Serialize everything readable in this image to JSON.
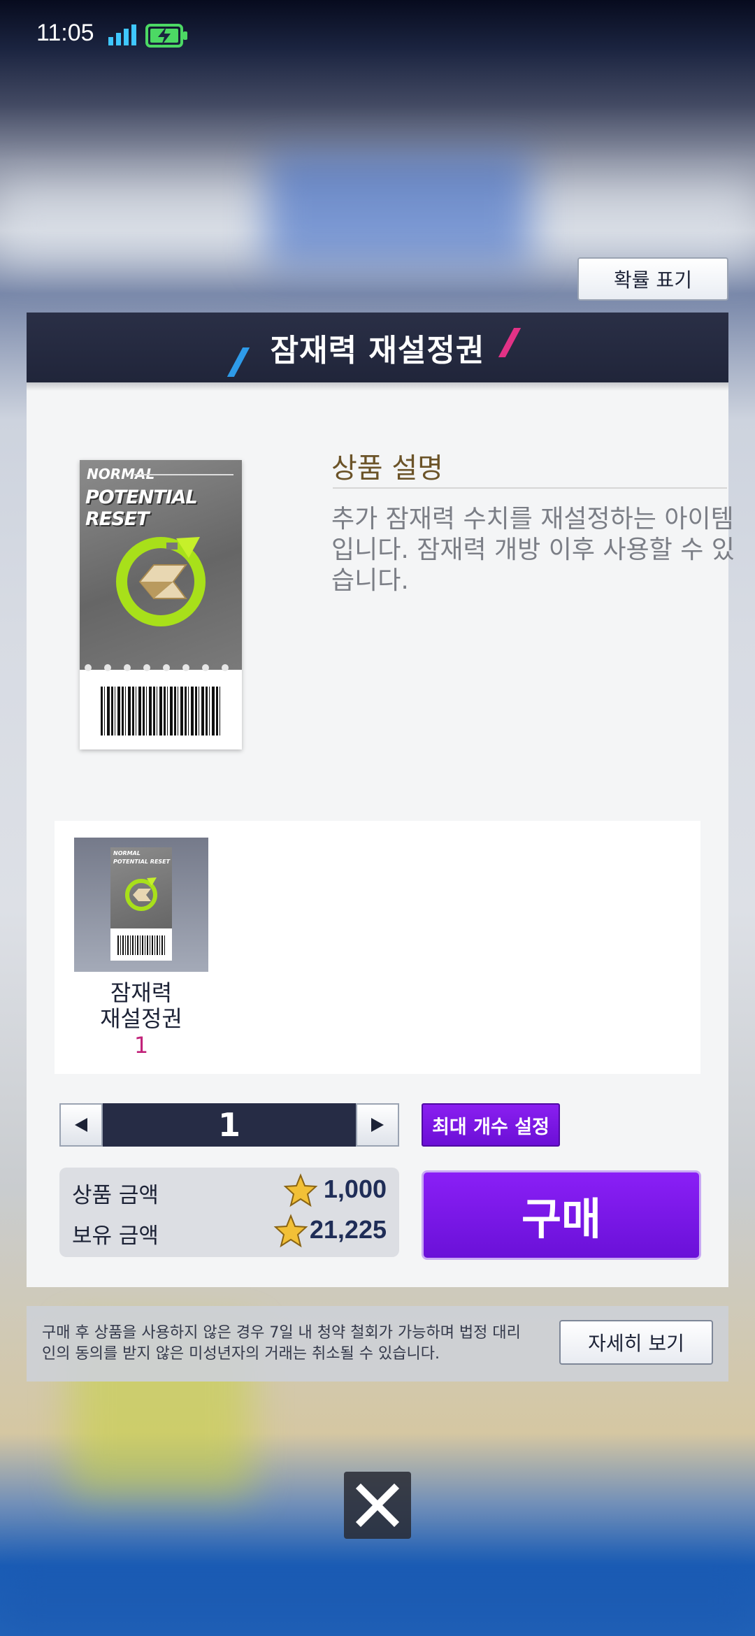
{
  "status_bar": {
    "time": "11:05"
  },
  "top": {
    "probability_button": "확률 표기"
  },
  "panel": {
    "title": "잠재력 재설정권",
    "ticket": {
      "line1": "NORMAL",
      "line2": "POTENTIAL RESET"
    },
    "description": {
      "heading": "상품 설명",
      "body": "추가 잠재력 수치를 재설정하는 아이템입니다. 잠재력 개방 이후 사용할 수 있습니다."
    },
    "contents": [
      {
        "name_line1": "잠재력",
        "name_line2": "재설정권",
        "count": "1"
      }
    ],
    "quantity": {
      "value": "1",
      "max_button": "최대 개수 설정"
    },
    "price": {
      "product_label": "상품 금액",
      "product_value": "1,000",
      "owned_label": "보유 금액",
      "owned_value": "21,225"
    },
    "buy_button": "구매"
  },
  "notice": {
    "text": "구매 후 상품을 사용하지 않은 경우 7일 내 청약 철회가 가능하며 법정 대리인의 동의를 받지 않은 미성년자의 거래는 취소될 수 있습니다.",
    "detail_button": "자세히 보기"
  },
  "colors": {
    "accent_purple": "#7a16e6",
    "header_navy": "#23283d",
    "count_pink": "#c2237a",
    "heading_brown": "#6b5328"
  },
  "icons": [
    "signal-icon",
    "battery-charging-icon",
    "arrow-left-icon",
    "arrow-right-icon",
    "star-coin-icon",
    "close-icon",
    "reset-arrow-icon",
    "barcode-icon"
  ]
}
